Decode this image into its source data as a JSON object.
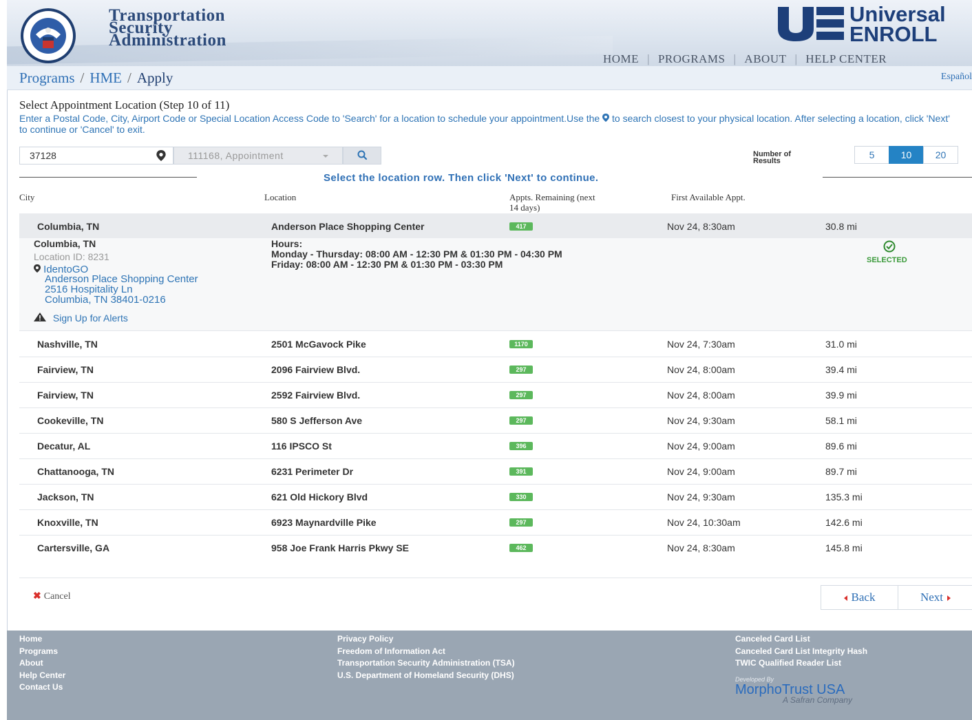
{
  "header": {
    "org_line1": "Transportation",
    "org_line2": "Security",
    "org_line3": "Administration",
    "brand_line1": "Universal",
    "brand_line2": "ENROLL",
    "nav": [
      "HOME",
      "PROGRAMS",
      "ABOUT",
      "HELP CENTER"
    ]
  },
  "breadcrumb": {
    "items": [
      "Programs",
      "HME",
      "Apply"
    ],
    "language_link": "Español"
  },
  "step": {
    "title": "Select Appointment Location (Step 10 of 11)",
    "instructions_part1": "Enter a Postal Code, City, Airport Code or Special Location Access Code to 'Search' for a location to schedule your appointment.Use the ",
    "instructions_part2": " to search closest to your physical location. After selecting a location, click 'Next' to continue or 'Cancel' to exit."
  },
  "search": {
    "location_value": "37128",
    "appointment_value": "111168, Appointment",
    "results_label_1": "Number of",
    "results_label_2": "Results",
    "page_sizes": [
      "5",
      "10",
      "20"
    ],
    "active_page_size": "10"
  },
  "select_message": "Select the location row. Then click 'Next' to continue.",
  "table": {
    "headers": {
      "city": "City",
      "location": "Location",
      "remaining_1": "Appts. Remaining (next",
      "remaining_2": "14 days)",
      "first": "First Available Appt."
    },
    "rows": [
      {
        "city": "Columbia, TN",
        "location": "Anderson Place Shopping Center",
        "remaining": "417",
        "first": "Nov 24, 8:30am",
        "distance": "30.8 mi"
      },
      {
        "city": "Nashville, TN",
        "location": "2501 McGavock Pike",
        "remaining": "1170",
        "first": "Nov 24, 7:30am",
        "distance": "31.0 mi"
      },
      {
        "city": "Fairview, TN",
        "location": "2096 Fairview Blvd.",
        "remaining": "297",
        "first": "Nov 24, 8:00am",
        "distance": "39.4 mi"
      },
      {
        "city": "Fairview, TN",
        "location": "2592 Fairview Blvd.",
        "remaining": "297",
        "first": "Nov 24, 8:00am",
        "distance": "39.9 mi"
      },
      {
        "city": "Cookeville, TN",
        "location": "580 S Jefferson Ave",
        "remaining": "297",
        "first": "Nov 24, 9:30am",
        "distance": "58.1 mi"
      },
      {
        "city": "Decatur, AL",
        "location": "116 IPSCO St",
        "remaining": "396",
        "first": "Nov 24, 9:00am",
        "distance": "89.6 mi"
      },
      {
        "city": "Chattanooga, TN",
        "location": "6231 Perimeter Dr",
        "remaining": "391",
        "first": "Nov 24, 9:00am",
        "distance": "89.7 mi"
      },
      {
        "city": "Jackson, TN",
        "location": "621 Old Hickory Blvd",
        "remaining": "330",
        "first": "Nov 24, 9:30am",
        "distance": "135.3 mi"
      },
      {
        "city": "Knoxville, TN",
        "location": "6923 Maynardville Pike",
        "remaining": "297",
        "first": "Nov 24, 10:30am",
        "distance": "142.6 mi"
      },
      {
        "city": "Cartersville, GA",
        "location": "958 Joe Frank Harris Pkwy SE",
        "remaining": "462",
        "first": "Nov 24, 8:30am",
        "distance": "145.8 mi"
      }
    ]
  },
  "selected_detail": {
    "city": "Columbia, TN",
    "location_id": "Location ID: 8231",
    "vendor": "IdentoGO",
    "address_1": "Anderson Place Shopping Center",
    "address_2": "2516 Hospitality Ln",
    "address_3": "Columbia, TN 38401-0216",
    "alerts_link": "Sign Up for Alerts",
    "hours_label": "Hours:",
    "hours_1": "Monday - Thursday: 08:00 AM - 12:30 PM & 01:30 PM - 04:30 PM",
    "hours_2": "Friday: 08:00 AM - 12:30 PM & 01:30 PM - 03:30 PM",
    "selected_label": "SELECTED"
  },
  "actions": {
    "cancel": "Cancel",
    "back": "Back",
    "next": "Next"
  },
  "footer": {
    "col1": [
      "Home",
      "Programs",
      "About",
      "Help Center",
      "Contact Us"
    ],
    "col2": [
      "Privacy Policy",
      "Freedom of Information Act",
      "Transportation Security Administration (TSA)",
      "U.S. Department of Homeland Security (DHS)"
    ],
    "col3": [
      "Canceled Card List",
      "Canceled Card List Integrity Hash",
      "TWIC Qualified Reader List"
    ],
    "developed_by": "Developed By",
    "developer": "MorphoTrust USA",
    "developer_tagline": "A Safran Company"
  },
  "colors": {
    "link_blue": "#2e74b5",
    "badge_green": "#5cb85c",
    "active_page": "#2483c5",
    "footer_bg": "#9aa6b3",
    "cancel_red": "#d9302c"
  },
  "icons": [
    "dhs-seal-icon",
    "map-pin-icon",
    "search-icon",
    "caret-down-icon",
    "warning-icon",
    "check-circle-icon",
    "close-icon",
    "triangle-left-icon",
    "triangle-right-icon"
  ]
}
